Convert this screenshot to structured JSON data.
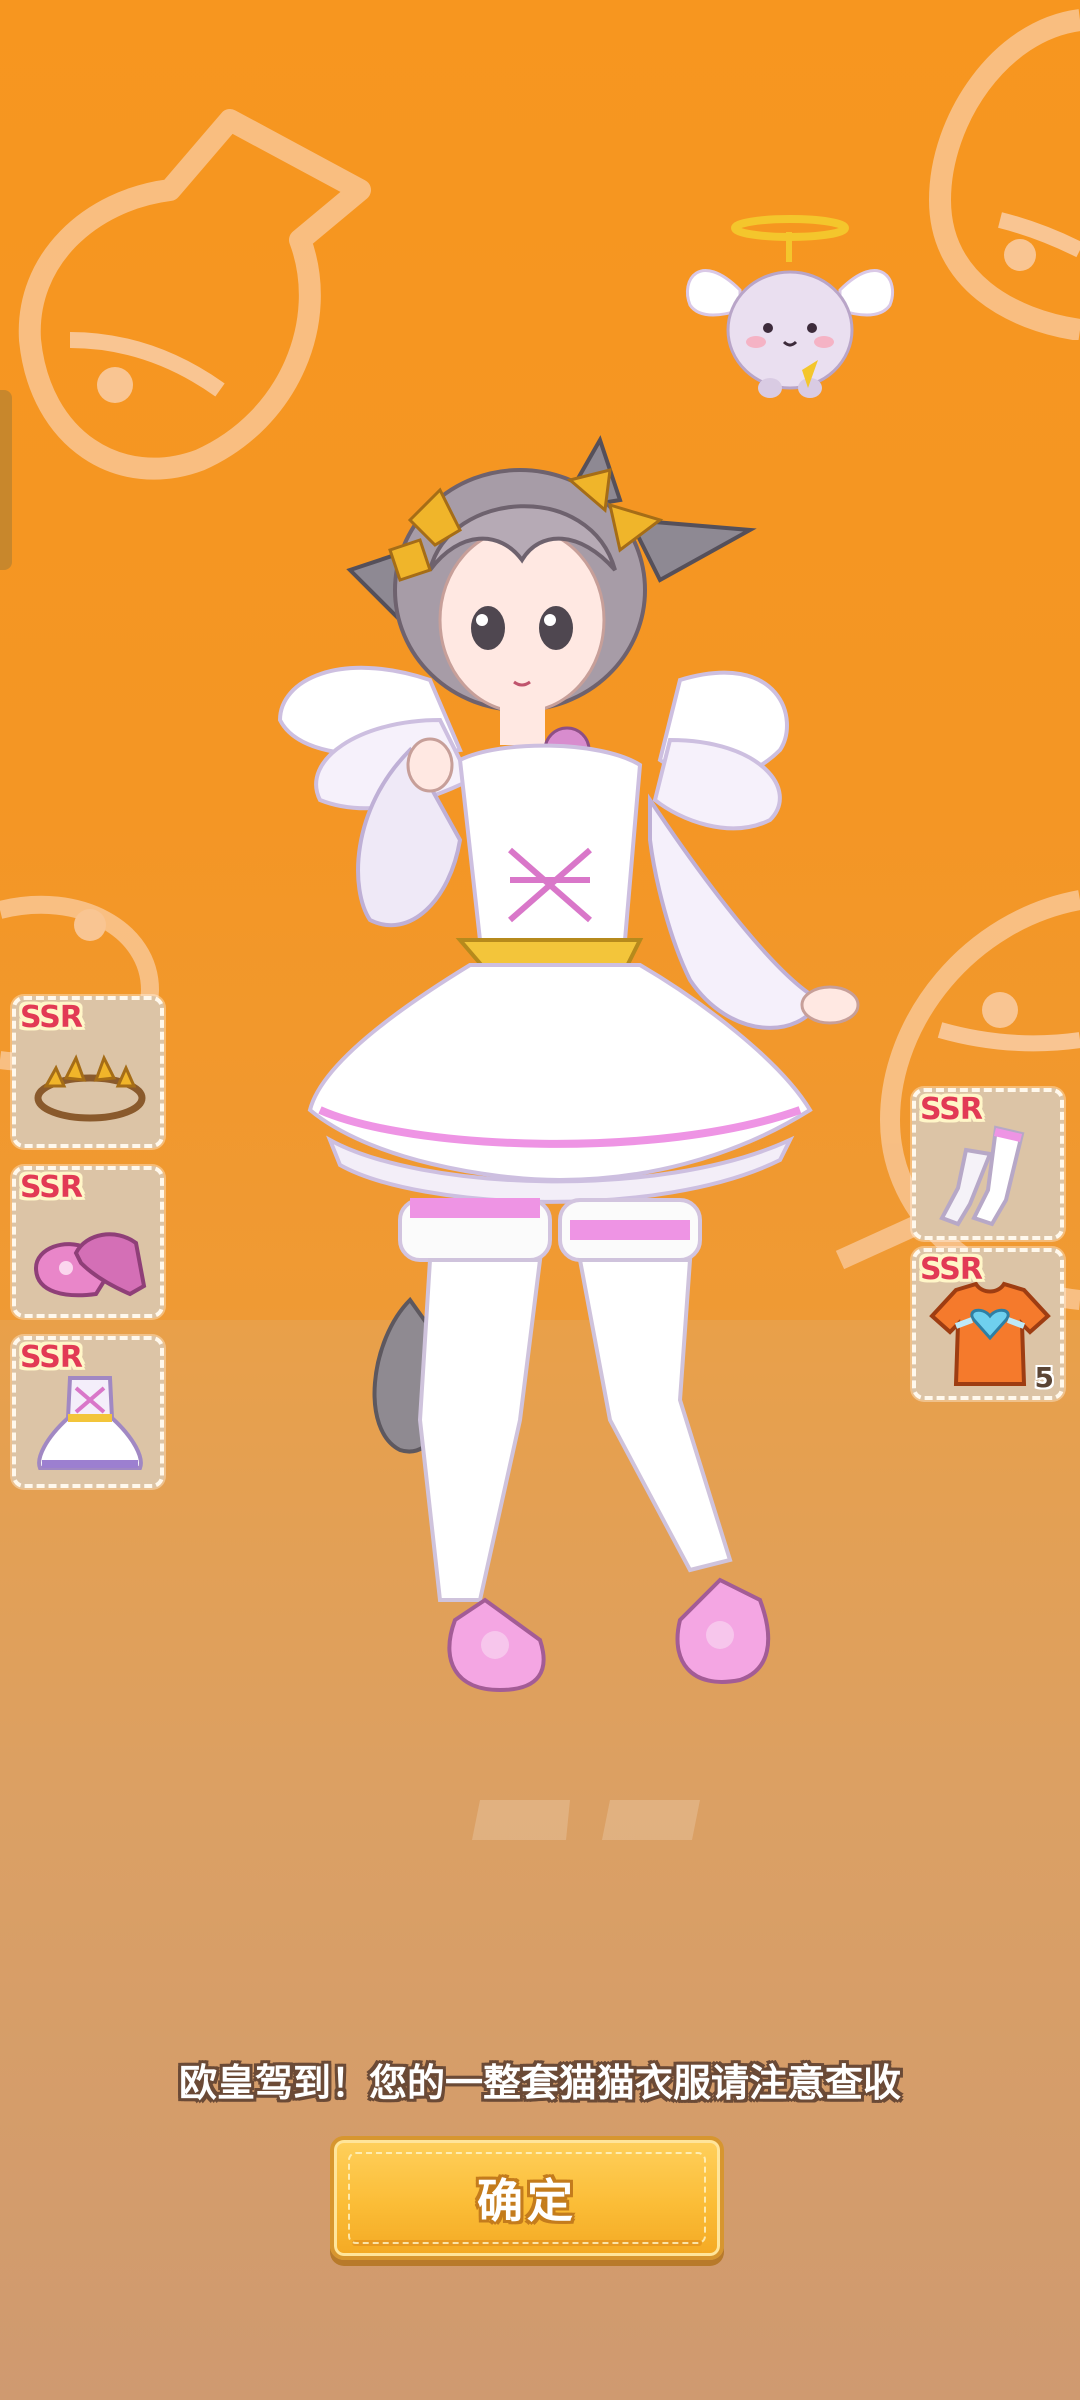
{
  "screen": {
    "message": "欧皇驾到！您的一整套猫猫衣服请注意查收",
    "confirm_label": "确定"
  },
  "colors": {
    "background": "#f7961f",
    "floor": "#dba064",
    "button": "#fbbd37",
    "rarity": "#e23a55"
  },
  "left_items": [
    {
      "rarity": "SSR",
      "icon": "laurel-crown-icon"
    },
    {
      "rarity": "SSR",
      "icon": "mary-jane-shoes-icon"
    },
    {
      "rarity": "SSR",
      "icon": "angel-dress-icon"
    }
  ],
  "right_items": [
    {
      "rarity": "SSR",
      "icon": "stockings-icon"
    },
    {
      "rarity": "SSR",
      "icon": "orange-tshirt-icon",
      "count": "5"
    }
  ],
  "scene": {
    "character": "angel-cat-girl-character",
    "pet": "flying-angel-cat-pet"
  }
}
